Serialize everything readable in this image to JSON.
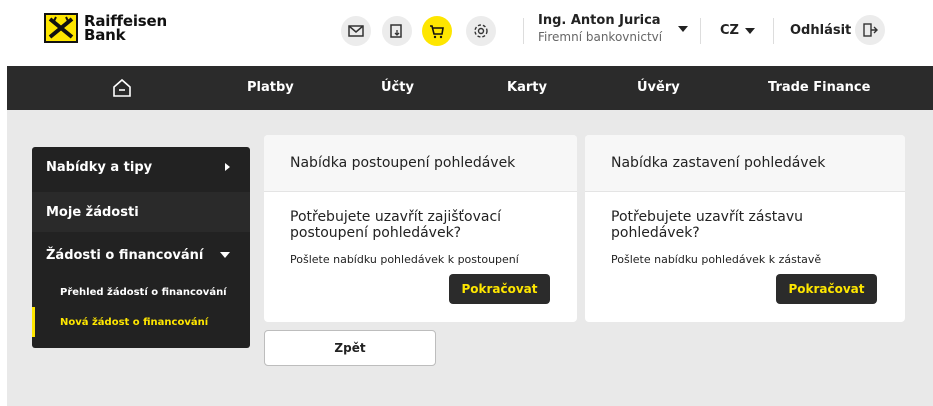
{
  "brand": {
    "line1": "Raiffeisen",
    "line2": "Bank",
    "accent": "#fee600",
    "dark": "#2b2b2b"
  },
  "header": {
    "icons": [
      "mail-icon",
      "documents-icon",
      "cart-icon",
      "settings-icon"
    ],
    "user_name": "Ing. Anton Jurica",
    "user_role": "Firemní bankovnictví",
    "language": "CZ",
    "logout_label": "Odhlásit"
  },
  "nav": {
    "items": [
      {
        "label": "Platby"
      },
      {
        "label": "Účty"
      },
      {
        "label": "Karty"
      },
      {
        "label": "Úvěry"
      },
      {
        "label": "Trade Finance"
      }
    ]
  },
  "sidebar": {
    "items": [
      {
        "label": "Nabídky a tipy"
      },
      {
        "label": "Moje žádosti"
      },
      {
        "label": "Žádosti o financování"
      }
    ],
    "subitems": [
      {
        "label": "Přehled žádostí o financování"
      },
      {
        "label": "Nová žádost o financování"
      }
    ]
  },
  "cards": [
    {
      "title": "Nabídka postoupení pohledávek",
      "question": "Potřebujete uzavřít zajišťovací postoupení pohledávek?",
      "desc": "Pošlete nabídku pohledávek k postoupení",
      "button": "Pokračovat"
    },
    {
      "title": "Nabídka zastavení pohledávek",
      "question": "Potřebujete uzavřít zástavu pohledávek?",
      "desc": "Pošlete nabídku pohledávek k zástavě",
      "button": "Pokračovat"
    }
  ],
  "back_label": "Zpět"
}
